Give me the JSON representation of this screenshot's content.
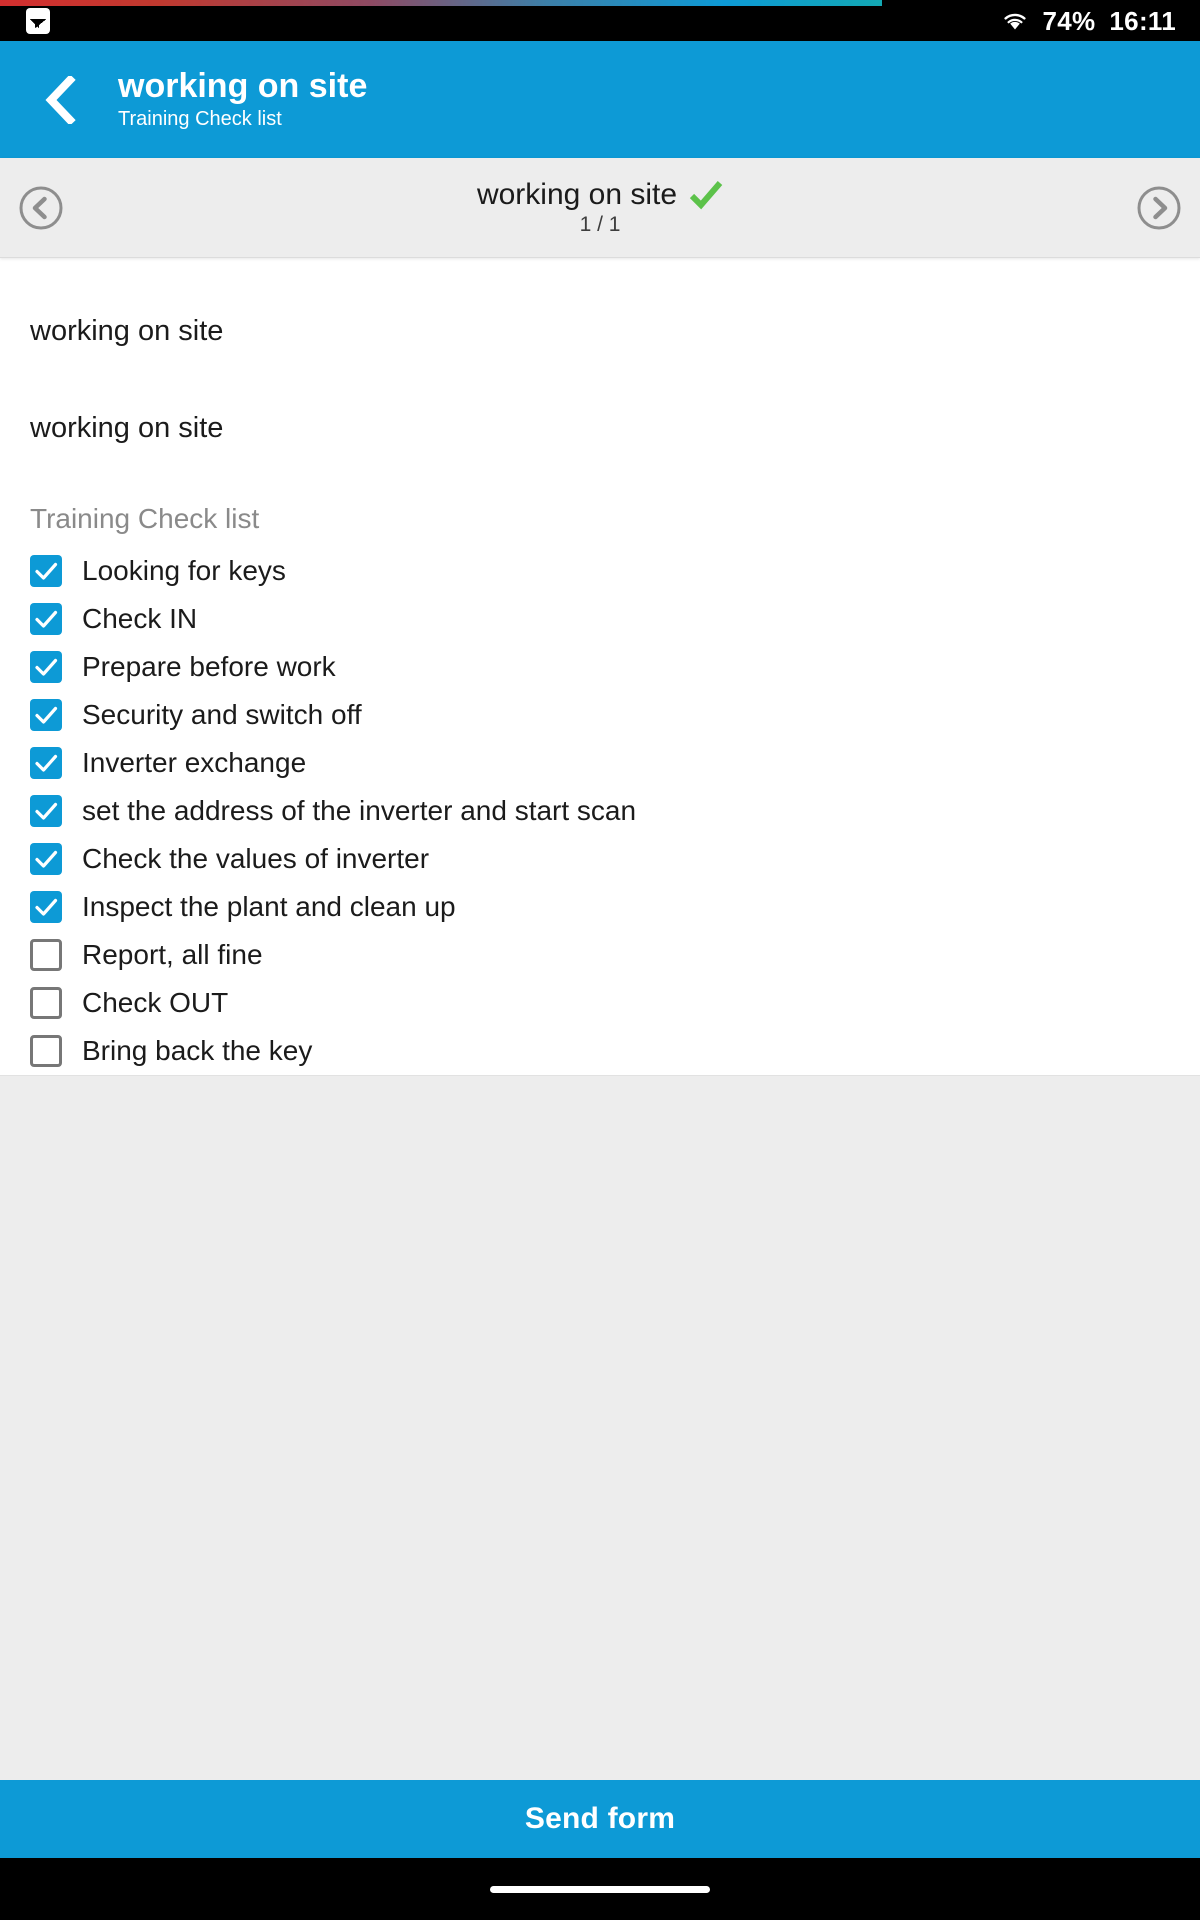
{
  "status_bar": {
    "notification_icon": "screenshot-image-icon",
    "wifi_icon": "wifi-icon",
    "battery_percent": "74%",
    "time": "16:11",
    "progress_accent_colors": [
      "#d32f2f",
      "#8e4a63",
      "#0d9ad6",
      "#13a8b4"
    ]
  },
  "app_bar": {
    "back_icon": "back-chevron-icon",
    "title": "working on site",
    "subtitle": "Training Check list",
    "background_color": "#0d9ad6"
  },
  "pager": {
    "prev_icon": "chevron-left-circle-icon",
    "next_icon": "chevron-right-circle-icon",
    "title": "working on site",
    "completed_icon": "green-check-icon",
    "completed_color": "#5cc24a",
    "counter": "1 / 1"
  },
  "form": {
    "section_label": "working on site",
    "section_value": "working on site",
    "group_title": "Training Check list",
    "checklist": [
      {
        "label": "Looking for keys",
        "checked": true
      },
      {
        "label": "Check IN",
        "checked": true
      },
      {
        "label": "Prepare before work",
        "checked": true
      },
      {
        "label": "Security and switch off",
        "checked": true
      },
      {
        "label": "Inverter exchange",
        "checked": true
      },
      {
        "label": "set the address of the inverter and start scan",
        "checked": true
      },
      {
        "label": "Check the values of inverter",
        "checked": true
      },
      {
        "label": "Inspect the plant and clean up",
        "checked": true
      },
      {
        "label": "Report, all fine",
        "checked": false
      },
      {
        "label": "Check OUT",
        "checked": false
      },
      {
        "label": "Bring back the key",
        "checked": false
      }
    ],
    "checkbox_checked_color": "#0d9ad6",
    "checkbox_unchecked_border_color": "#777777"
  },
  "footer": {
    "send_label": "Send form",
    "send_background": "#0d9ad6"
  },
  "nav_bar": {
    "home_indicator": "home-indicator"
  }
}
